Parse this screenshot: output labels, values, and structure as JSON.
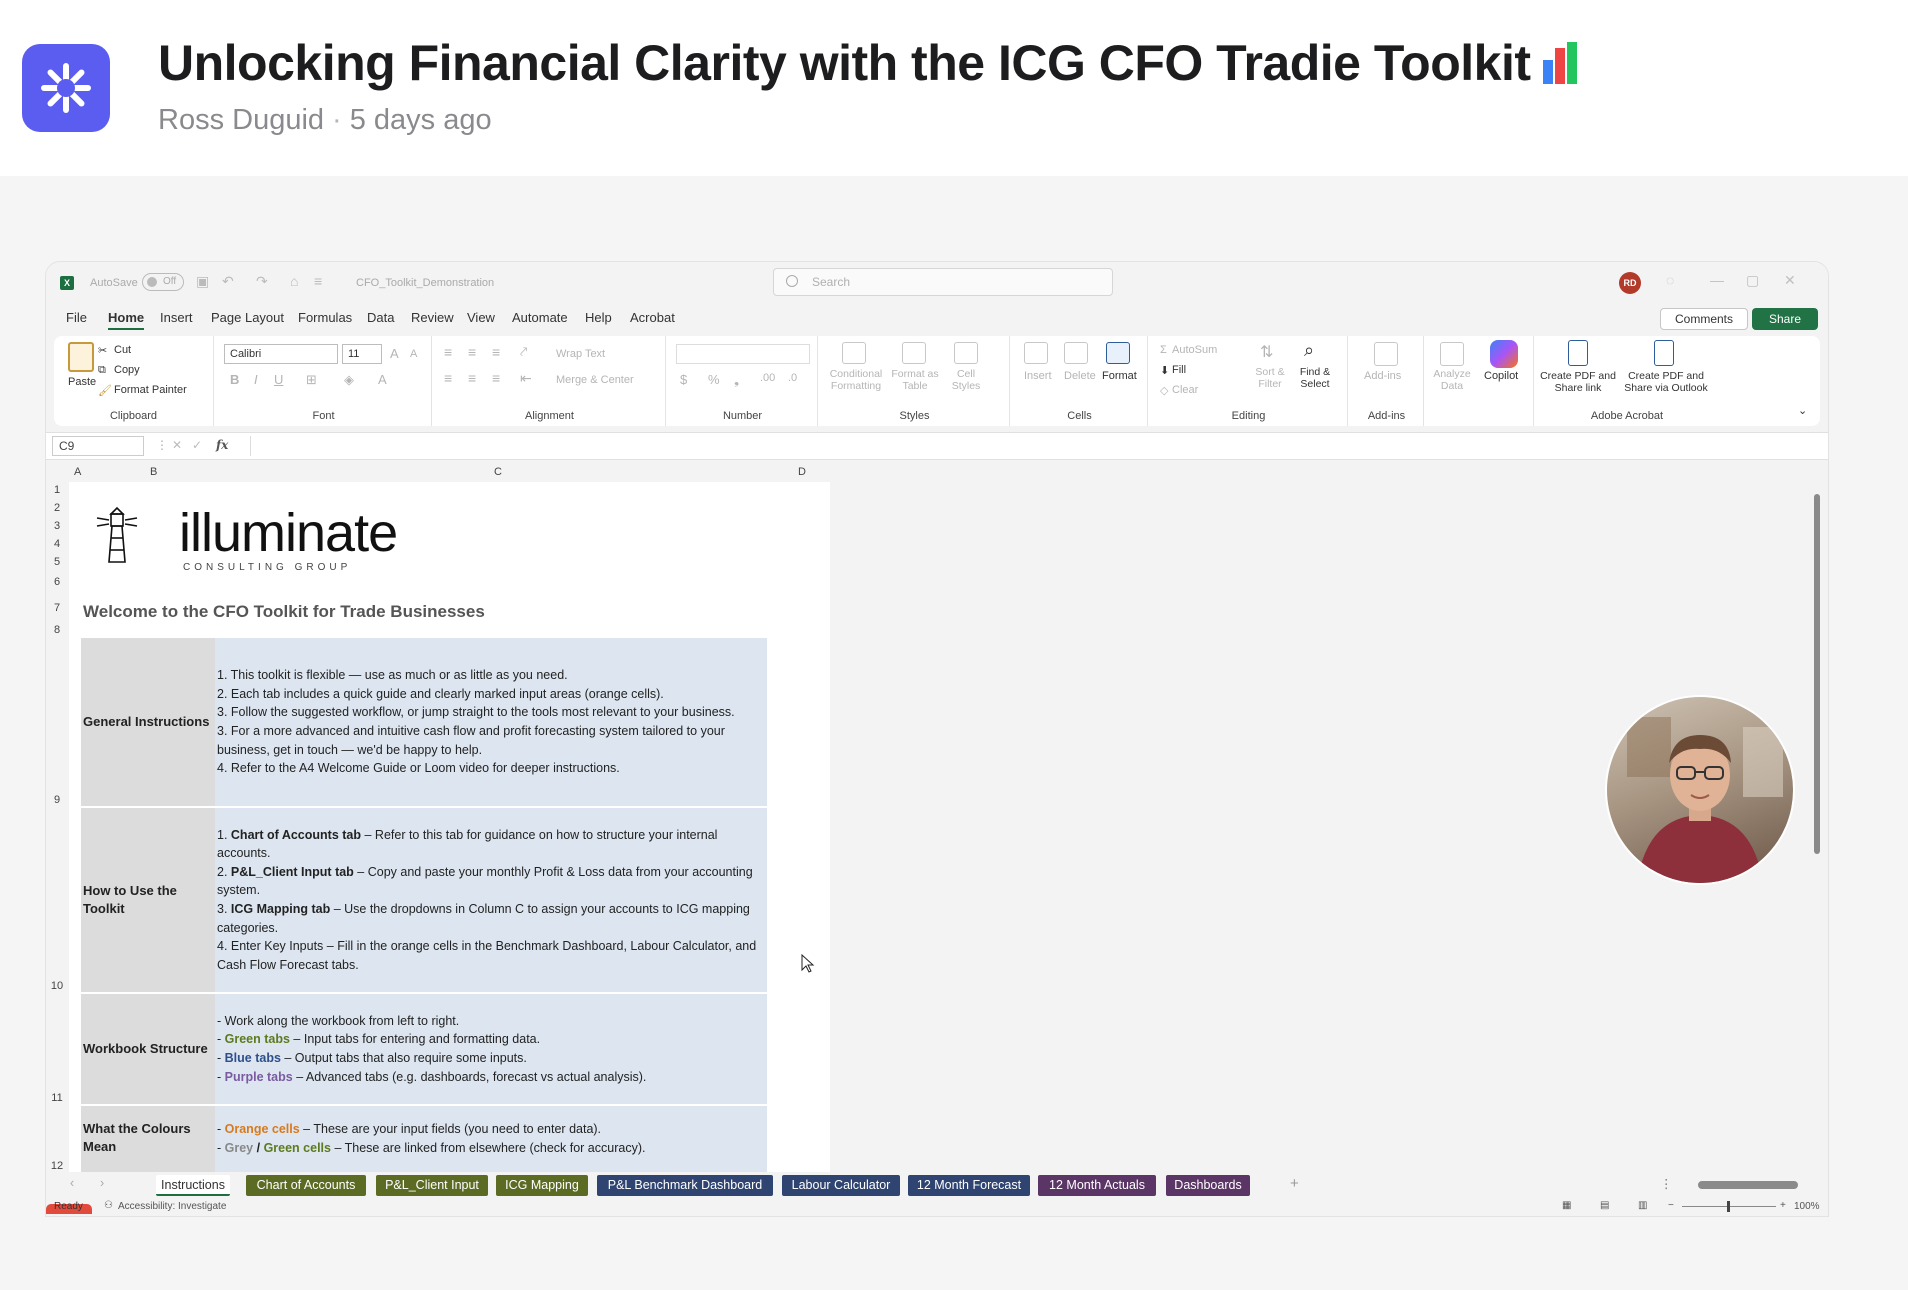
{
  "header": {
    "title": "Unlocking Financial Clarity with the ICG CFO Tradie Toolkit",
    "author": "Ross Duguid",
    "time": "5 days ago"
  },
  "excel": {
    "autosave_label": "AutoSave",
    "autosave_state": "Off",
    "filename": "CFO_Toolkit_Demonstration",
    "search_placeholder": "Search",
    "avatar_initials": "RD",
    "menu": [
      "File",
      "Home",
      "Insert",
      "Page Layout",
      "Formulas",
      "Data",
      "Review",
      "View",
      "Automate",
      "Help",
      "Acrobat"
    ],
    "comments_label": "Comments",
    "share_label": "Share",
    "ribbon": {
      "clipboard": {
        "paste": "Paste",
        "cut": "Cut",
        "copy": "Copy",
        "format_painter": "Format Painter",
        "label": "Clipboard"
      },
      "font": {
        "name": "Calibri",
        "size": "11",
        "label": "Font"
      },
      "alignment": {
        "wrap": "Wrap Text",
        "merge": "Merge & Center",
        "label": "Alignment"
      },
      "number": {
        "label": "Number",
        "currency": "$",
        "percent": "%"
      },
      "styles": {
        "conditional": "Conditional Formatting",
        "format_table": "Format as Table",
        "cell_styles": "Cell Styles",
        "label": "Styles"
      },
      "cells": {
        "insert": "Insert",
        "delete": "Delete",
        "format": "Format",
        "label": "Cells"
      },
      "editing": {
        "autosum": "AutoSum",
        "fill": "Fill",
        "clear": "Clear",
        "sort": "Sort & Filter",
        "find": "Find & Select",
        "label": "Editing"
      },
      "addins": {
        "addins": "Add-ins",
        "label": "Add-ins"
      },
      "analyze": "Analyze Data",
      "copilot": "Copilot",
      "acrobat": {
        "pdf_link": "Create PDF and Share link",
        "pdf_outlook": "Create PDF and Share via Outlook",
        "label": "Adobe Acrobat"
      }
    },
    "name_box": "C9",
    "columns": [
      "A",
      "B",
      "C",
      "D"
    ],
    "rows": [
      "1",
      "2",
      "3",
      "4",
      "5",
      "6",
      "7",
      "8",
      "9",
      "10",
      "11",
      "12"
    ],
    "brand": "illuminate",
    "brand_sub": "CONSULTING GROUP",
    "welcome": "Welcome to the CFO Toolkit for Trade Businesses",
    "sections": [
      {
        "label": "General Instructions",
        "lines": [
          "1. This toolkit is flexible — use as much or as little as you need.",
          "2. Each tab includes a quick guide and clearly marked input areas (orange cells).",
          "3. Follow the suggested workflow, or jump straight to the tools most relevant to your business.",
          "3. For a more advanced and intuitive cash flow and profit forecasting system tailored to your business, get in touch — we'd be happy to help.",
          "4. Refer to the A4 Welcome Guide or Loom video for deeper instructions."
        ]
      },
      {
        "label": "How to Use the Toolkit",
        "items": [
          {
            "num": "1. ",
            "bold": "Chart of Accounts tab",
            "rest": " – Refer to this tab for guidance on how to structure your internal accounts."
          },
          {
            "num": "2. ",
            "bold": "P&L_Client Input tab",
            "rest": " – Copy and paste your monthly Profit & Loss data from your accounting system."
          },
          {
            "num": "3. ",
            "bold": "ICG Mapping tab",
            "rest": " – Use the dropdowns in Column C to assign your accounts to ICG mapping categories."
          },
          {
            "num": "",
            "bold": "",
            "rest": "4. Enter Key Inputs – Fill in the orange cells in the Benchmark Dashboard, Labour Calculator, and Cash Flow Forecast tabs."
          }
        ]
      },
      {
        "label": "Workbook Structure",
        "line1": "- Work along the workbook from left to right.",
        "green": "Green tabs",
        "green_rest": " – Input tabs for entering and formatting data.",
        "blue": "Blue tabs",
        "blue_rest": " – Output tabs that also require some inputs.",
        "purple": "Purple tabs",
        "purple_rest": " – Advanced tabs (e.g. dashboards, forecast vs actual analysis)."
      },
      {
        "label": "What the Colours Mean",
        "orange": "Orange cells",
        "orange_rest": " – These are your input fields (you need to enter data).",
        "grey": "Grey",
        "slash": " / ",
        "green": "Green cells",
        "grey_rest": " – These are linked from elsewhere (check for accuracy)."
      }
    ],
    "tabs": [
      "Instructions",
      "Chart of Accounts",
      "P&L_Client Input",
      "ICG Mapping",
      "P&L Benchmark Dashboard",
      "Labour Calculator",
      "12 Month Forecast",
      "12 Month Actuals",
      "Dashboards"
    ],
    "status": {
      "ready": "Ready",
      "accessibility": "Accessibility: Investigate",
      "zoom": "100%"
    }
  },
  "colors": {
    "accent": "#5b5cf0",
    "excel_green": "#217346",
    "tab_green": "#5c6b23",
    "tab_blue": "#2f4470",
    "tab_purple": "#5a3566"
  }
}
